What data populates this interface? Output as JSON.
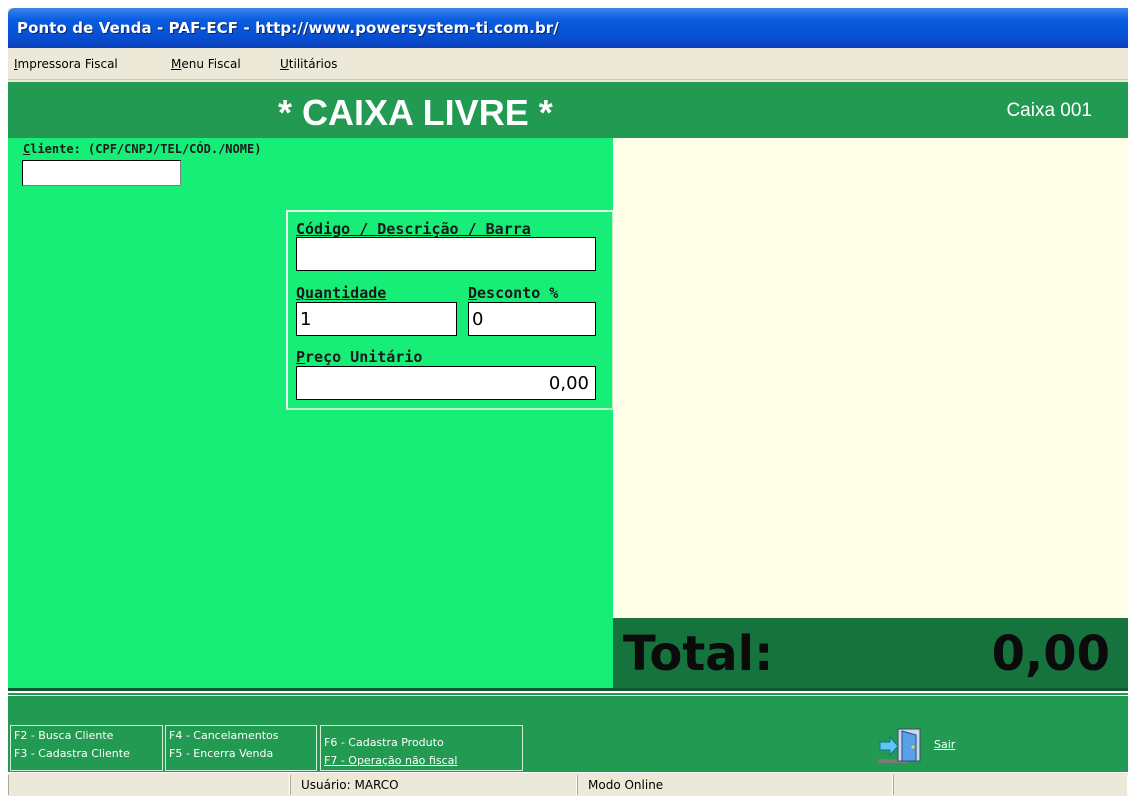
{
  "window": {
    "title": "Ponto de Venda - PAF-ECF - http://www.powersystem-ti.com.br/"
  },
  "menu": {
    "items": [
      {
        "mnemonic": "I",
        "rest": "mpressora Fiscal"
      },
      {
        "mnemonic": "M",
        "rest": "enu Fiscal"
      },
      {
        "mnemonic": "U",
        "rest": "tilitários"
      }
    ]
  },
  "header": {
    "status": "* CAIXA LIVRE *",
    "caixa": "Caixa 001"
  },
  "cliente": {
    "mnemonic": "C",
    "rest": "liente: (CPF/CNPJ/TEL/CÓD./NOME)",
    "value": ""
  },
  "item": {
    "codigo": {
      "mnemonic": "C",
      "rest": "ódigo / Descrição / Barra",
      "value": ""
    },
    "quantidade": {
      "label": "Quantidade",
      "value": "1"
    },
    "desconto": {
      "mnemonic": "D",
      "rest": "esconto %",
      "value": "0"
    },
    "preco": {
      "mnemonic": "P",
      "rest": "reço Unitário",
      "value": "0,00"
    }
  },
  "total": {
    "label": "Total:",
    "value": "0,00"
  },
  "shortcuts": {
    "f2": "F2 - Busca Cliente",
    "f3": "F3 - Cadastra Cliente",
    "f4": "F4 - Cancelamentos",
    "f5": "F5 - Encerra Venda",
    "f6": "F6 - Cadastra Produto",
    "f7": "F7 - Operação não fiscal",
    "sair": "Sair"
  },
  "statusbar": {
    "usuario": "Usuário: MARCO",
    "modo": "Modo Online"
  },
  "colors": {
    "header_green": "#239a52",
    "panel_green": "#17ee78",
    "total_green": "#17733e",
    "cart_bg": "#fefde7"
  },
  "icons": {
    "sair": "exit-door-icon"
  }
}
